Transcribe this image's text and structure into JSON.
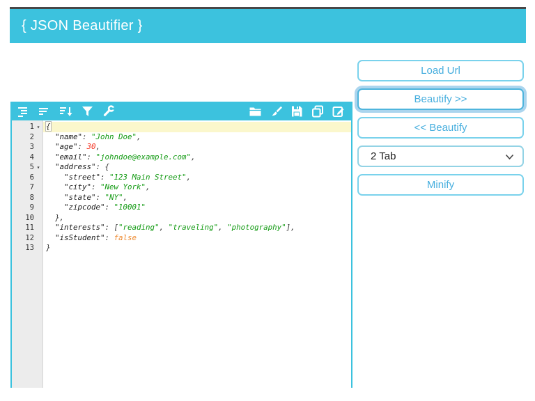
{
  "header": {
    "title": "{ JSON Beautifier }"
  },
  "colors": {
    "accent_cyan": "#3cc2de",
    "button_border": "#7ad2ec",
    "button_text": "#46aede",
    "active_line_bg": "#fbf7cc",
    "gutter_bg": "#ececec",
    "syntax_key": "#1b1b1b",
    "syntax_string": "#129a12",
    "syntax_number": "#f42d1b",
    "syntax_boolean": "#ee8a30"
  },
  "toolbar": {
    "icons_left": [
      "format-indent-icon",
      "compact-icon",
      "sort-icon",
      "filter-icon",
      "wrench-icon"
    ],
    "icons_right": [
      "folder-icon",
      "brush-icon",
      "save-icon",
      "copy-icon",
      "edit-icon"
    ]
  },
  "editor": {
    "active_line": 1,
    "lines": [
      {
        "n": 1,
        "fold": true,
        "active": true,
        "tokens": [
          {
            "t": "punc",
            "v": "{",
            "box": true
          }
        ]
      },
      {
        "n": 2,
        "tokens": [
          {
            "t": "ws",
            "v": "  "
          },
          {
            "t": "key",
            "v": "\"name\""
          },
          {
            "t": "punc",
            "v": ": "
          },
          {
            "t": "str",
            "v": "\"John Doe\""
          },
          {
            "t": "punc",
            "v": ","
          }
        ]
      },
      {
        "n": 3,
        "tokens": [
          {
            "t": "ws",
            "v": "  "
          },
          {
            "t": "key",
            "v": "\"age\""
          },
          {
            "t": "punc",
            "v": ": "
          },
          {
            "t": "num",
            "v": "30"
          },
          {
            "t": "punc",
            "v": ","
          }
        ]
      },
      {
        "n": 4,
        "tokens": [
          {
            "t": "ws",
            "v": "  "
          },
          {
            "t": "key",
            "v": "\"email\""
          },
          {
            "t": "punc",
            "v": ": "
          },
          {
            "t": "str",
            "v": "\"johndoe@example.com\""
          },
          {
            "t": "punc",
            "v": ","
          }
        ]
      },
      {
        "n": 5,
        "fold": true,
        "tokens": [
          {
            "t": "ws",
            "v": "  "
          },
          {
            "t": "key",
            "v": "\"address\""
          },
          {
            "t": "punc",
            "v": ": "
          },
          {
            "t": "punc",
            "v": "{"
          }
        ]
      },
      {
        "n": 6,
        "tokens": [
          {
            "t": "ws",
            "v": "    "
          },
          {
            "t": "key",
            "v": "\"street\""
          },
          {
            "t": "punc",
            "v": ": "
          },
          {
            "t": "str",
            "v": "\"123 Main Street\""
          },
          {
            "t": "punc",
            "v": ","
          }
        ]
      },
      {
        "n": 7,
        "tokens": [
          {
            "t": "ws",
            "v": "    "
          },
          {
            "t": "key",
            "v": "\"city\""
          },
          {
            "t": "punc",
            "v": ": "
          },
          {
            "t": "str",
            "v": "\"New York\""
          },
          {
            "t": "punc",
            "v": ","
          }
        ]
      },
      {
        "n": 8,
        "tokens": [
          {
            "t": "ws",
            "v": "    "
          },
          {
            "t": "key",
            "v": "\"state\""
          },
          {
            "t": "punc",
            "v": ": "
          },
          {
            "t": "str",
            "v": "\"NY\""
          },
          {
            "t": "punc",
            "v": ","
          }
        ]
      },
      {
        "n": 9,
        "tokens": [
          {
            "t": "ws",
            "v": "    "
          },
          {
            "t": "key",
            "v": "\"zipcode\""
          },
          {
            "t": "punc",
            "v": ": "
          },
          {
            "t": "str",
            "v": "\"10001\""
          }
        ]
      },
      {
        "n": 10,
        "tokens": [
          {
            "t": "ws",
            "v": "  "
          },
          {
            "t": "punc",
            "v": "},"
          }
        ]
      },
      {
        "n": 11,
        "tokens": [
          {
            "t": "ws",
            "v": "  "
          },
          {
            "t": "key",
            "v": "\"interests\""
          },
          {
            "t": "punc",
            "v": ": ["
          },
          {
            "t": "str",
            "v": "\"reading\""
          },
          {
            "t": "punc",
            "v": ", "
          },
          {
            "t": "str",
            "v": "\"traveling\""
          },
          {
            "t": "punc",
            "v": ", "
          },
          {
            "t": "str",
            "v": "\"photography\""
          },
          {
            "t": "punc",
            "v": "],"
          }
        ]
      },
      {
        "n": 12,
        "tokens": [
          {
            "t": "ws",
            "v": "  "
          },
          {
            "t": "key",
            "v": "\"isStudent\""
          },
          {
            "t": "punc",
            "v": ": "
          },
          {
            "t": "bool",
            "v": "false"
          }
        ]
      },
      {
        "n": 13,
        "tokens": [
          {
            "t": "punc",
            "v": "}"
          }
        ]
      }
    ]
  },
  "side_panel": {
    "load_url": "Load Url",
    "beautify_forward": "Beautify >>",
    "beautify_back": "<< Beautify",
    "indent_value": "2 Tab",
    "minify": "Minify"
  }
}
